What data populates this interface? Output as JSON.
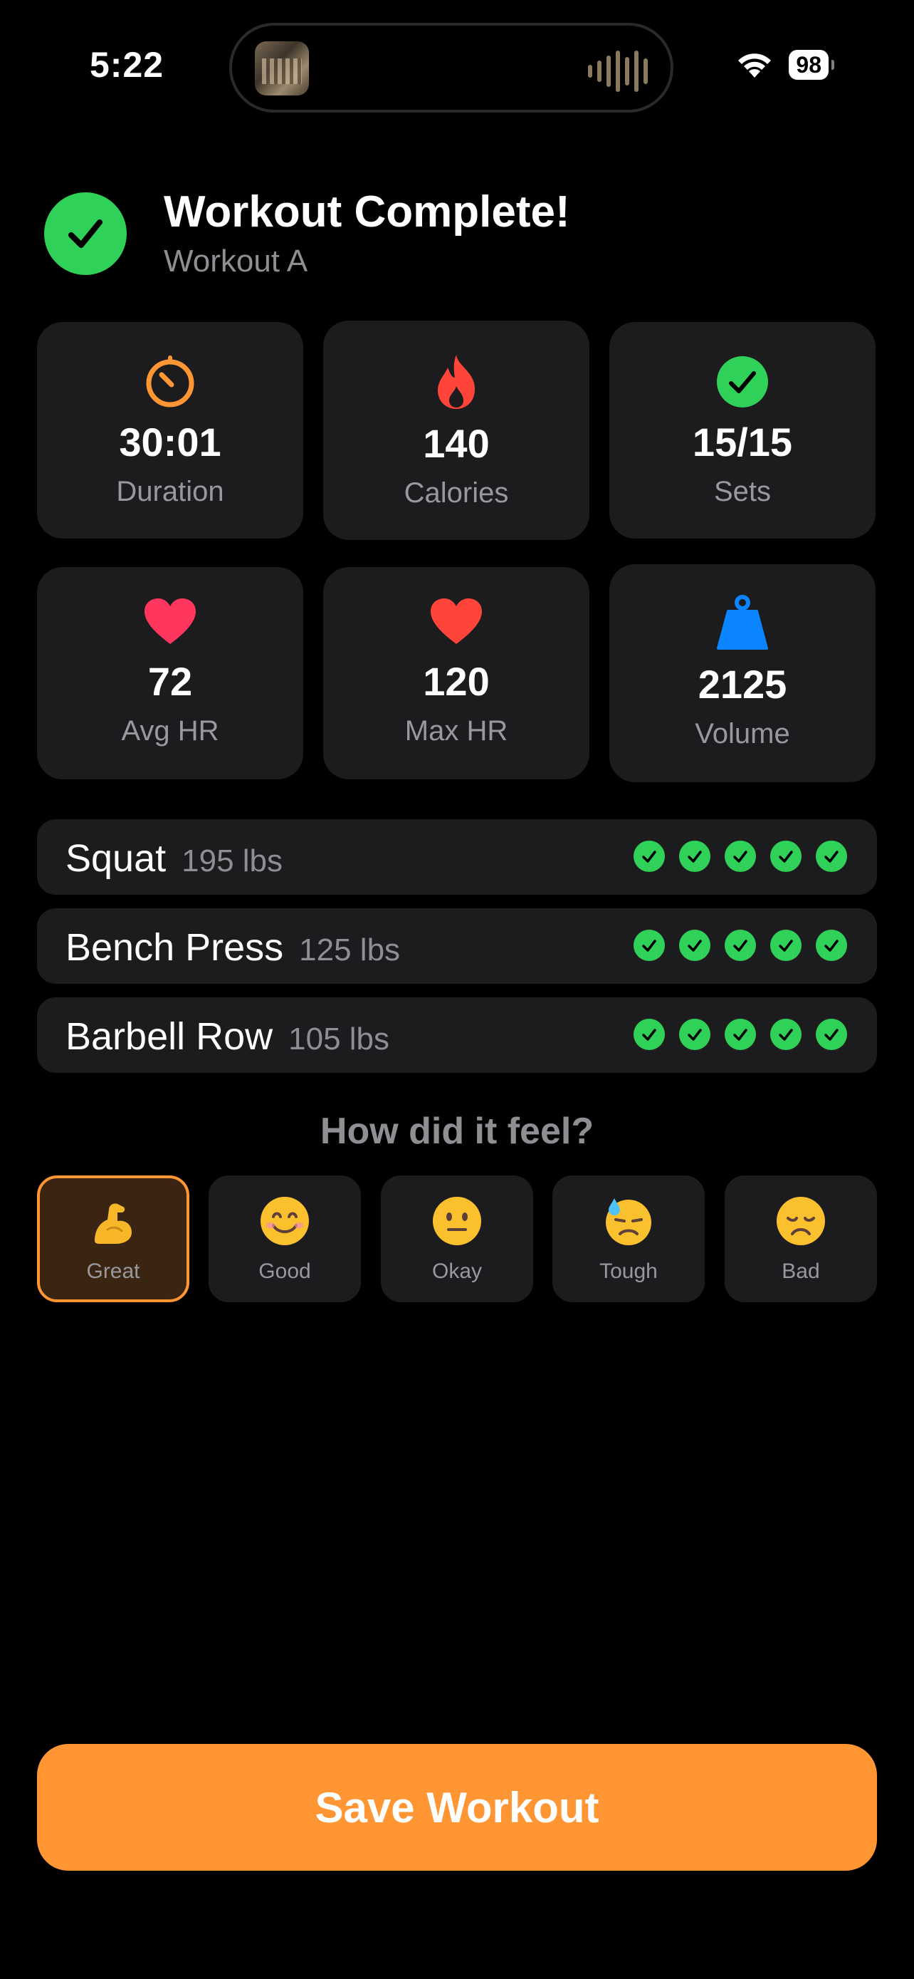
{
  "status_bar": {
    "time": "5:22",
    "battery": "98"
  },
  "header": {
    "title": "Workout Complete!",
    "subtitle": "Workout A"
  },
  "stats": [
    {
      "value": "30:01",
      "label": "Duration",
      "icon": "timer-icon",
      "color": "#ff9533"
    },
    {
      "value": "140",
      "label": "Calories",
      "icon": "flame-icon",
      "color": "#ff453a"
    },
    {
      "value": "15/15",
      "label": "Sets",
      "icon": "checkmark-circle-icon",
      "color": "#30d158"
    },
    {
      "value": "72",
      "label": "Avg HR",
      "icon": "heart-icon",
      "color": "#ff375f"
    },
    {
      "value": "120",
      "label": "Max HR",
      "icon": "heart-icon",
      "color": "#ff453a"
    },
    {
      "value": "2125",
      "label": "Volume",
      "icon": "scalemass-icon",
      "color": "#0a84ff"
    }
  ],
  "exercises": [
    {
      "name": "Squat",
      "weight": "195 lbs",
      "sets_completed": 5
    },
    {
      "name": "Bench Press",
      "weight": "125 lbs",
      "sets_completed": 5
    },
    {
      "name": "Barbell Row",
      "weight": "105 lbs",
      "sets_completed": 5
    }
  ],
  "feeling": {
    "title": "How did it feel?",
    "options": [
      {
        "label": "Great",
        "emoji": "flexed-biceps",
        "selected": true
      },
      {
        "label": "Good",
        "emoji": "smiling-face",
        "selected": false
      },
      {
        "label": "Okay",
        "emoji": "neutral-face",
        "selected": false
      },
      {
        "label": "Tough",
        "emoji": "downcast-sweat-face",
        "selected": false
      },
      {
        "label": "Bad",
        "emoji": "disappointed-face",
        "selected": false
      }
    ]
  },
  "save_button": {
    "label": "Save Workout"
  },
  "colors": {
    "accent": "#ff9533",
    "success": "#30d158",
    "card": "#1c1c1e"
  }
}
